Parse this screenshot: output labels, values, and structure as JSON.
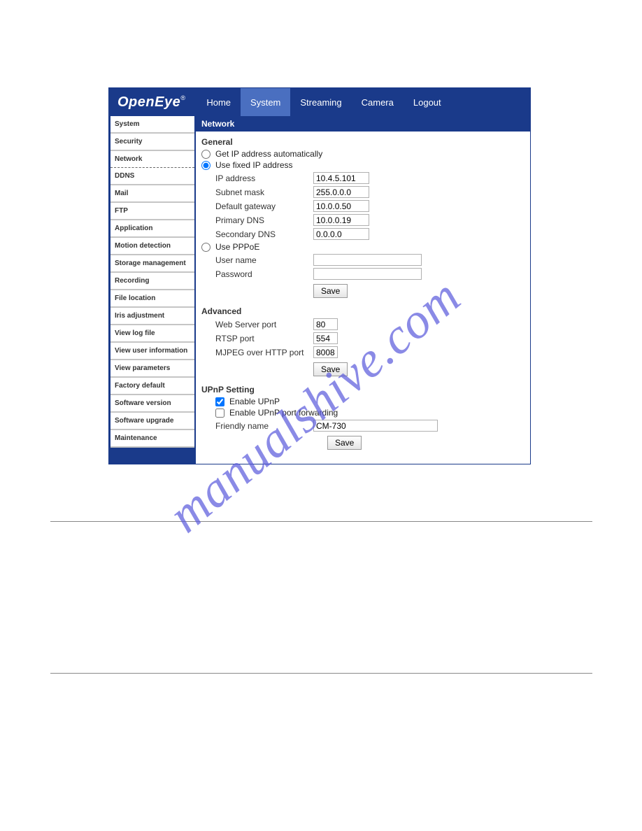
{
  "brand": {
    "name": "OpenEye",
    "reg": "®"
  },
  "topnav": [
    {
      "label": "Home",
      "active": false
    },
    {
      "label": "System",
      "active": true
    },
    {
      "label": "Streaming",
      "active": false
    },
    {
      "label": "Camera",
      "active": false
    },
    {
      "label": "Logout",
      "active": false
    }
  ],
  "sidebar": [
    {
      "label": "System"
    },
    {
      "label": "Security"
    },
    {
      "label": "Network",
      "selected": true
    },
    {
      "label": "DDNS"
    },
    {
      "label": "Mail"
    },
    {
      "label": "FTP"
    },
    {
      "label": "Application"
    },
    {
      "label": "Motion detection"
    },
    {
      "label": "Storage management"
    },
    {
      "label": "Recording"
    },
    {
      "label": "File location"
    },
    {
      "label": "Iris adjustment"
    },
    {
      "label": "View log file"
    },
    {
      "label": "View user information"
    },
    {
      "label": "View parameters"
    },
    {
      "label": "Factory default"
    },
    {
      "label": "Software version"
    },
    {
      "label": "Software upgrade"
    },
    {
      "label": "Maintenance"
    }
  ],
  "panel": {
    "title": "Network"
  },
  "general": {
    "heading": "General",
    "opt_auto": "Get IP address automatically",
    "opt_fixed": "Use fixed IP address",
    "opt_pppoe": "Use PPPoE",
    "mode": "fixed",
    "ip_label": "IP address",
    "ip": "10.4.5.101",
    "mask_label": "Subnet mask",
    "mask": "255.0.0.0",
    "gw_label": "Default gateway",
    "gw": "10.0.0.50",
    "dns1_label": "Primary DNS",
    "dns1": "10.0.0.19",
    "dns2_label": "Secondary DNS",
    "dns2": "0.0.0.0",
    "user_label": "User name",
    "user": "",
    "pass_label": "Password",
    "pass": "",
    "save": "Save"
  },
  "advanced": {
    "heading": "Advanced",
    "web_label": "Web Server port",
    "web": "80",
    "rtsp_label": "RTSP port",
    "rtsp": "554",
    "mjpeg_label": "MJPEG over HTTP port",
    "mjpeg": "8008",
    "save": "Save"
  },
  "upnp": {
    "heading": "UPnP Setting",
    "enable_label": "Enable UPnP",
    "enable": true,
    "fwd_label": "Enable UPnP port forwarding",
    "fwd": false,
    "name_label": "Friendly name",
    "name": "CM-730",
    "save": "Save"
  },
  "watermark": "manualshive.com"
}
